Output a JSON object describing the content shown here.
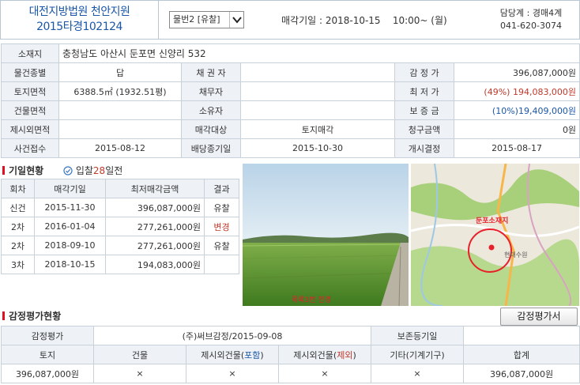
{
  "header": {
    "court_line1": "대전지방법원 천안지원",
    "court_line2": "2015타경102124",
    "item_select": "물번2 [유찰]",
    "sale_date_label": "매각기일 : 2018-10-15",
    "sale_time": "10:00~ (월)",
    "dept": "담당계 : 경매4계",
    "phone": "041-620-3074"
  },
  "info": {
    "address_label": "소재지",
    "address": "충청남도 아산시 둔포면 신양리 532",
    "type_label": "물건종별",
    "type": "답",
    "creditor_label": "채 권 자",
    "creditor": "",
    "appraisal_label": "감 정 가",
    "appraisal": "396,087,000원",
    "land_area_label": "토지면적",
    "land_area": "6388.5㎡ (1932.51평)",
    "debtor_label": "채무자",
    "debtor": "",
    "min_price_label": "최 저 가",
    "min_price": "(49%) 194,083,000원",
    "bldg_area_label": "건물면적",
    "bldg_area": "",
    "owner_label": "소유자",
    "owner": "",
    "deposit_label": "보 증 금",
    "deposit": "(10%)19,409,000원",
    "excluded_label": "제시외면적",
    "excluded": "",
    "target_label": "매각대상",
    "target": "토지매각",
    "claim_label": "청구금액",
    "claim": "0원",
    "case_recv_label": "사건접수",
    "case_recv": "2015-08-12",
    "dividend_label": "배당종기일",
    "dividend": "2015-10-30",
    "start_label": "개시결정",
    "start": "2015-08-17"
  },
  "history": {
    "title": "기일현황",
    "bid_prefix": "입찰",
    "bid_days": "28",
    "bid_suffix": "일전",
    "columns": [
      "회차",
      "매각기일",
      "최저매각금액",
      "결과"
    ],
    "rows": [
      {
        "round": "신건",
        "date": "2015-11-30",
        "price": "396,087,000원",
        "result": "유찰",
        "result_color": "#333333"
      },
      {
        "round": "2차",
        "date": "2016-01-04",
        "price": "277,261,000원",
        "result": "변경",
        "result_color": "#c0392b"
      },
      {
        "round": "2차",
        "date": "2018-09-10",
        "price": "277,261,000원",
        "result": "유찰",
        "result_color": "#333333"
      },
      {
        "round": "3차",
        "date": "2018-10-15",
        "price": "194,083,000원",
        "result": "",
        "result_color": "#333333"
      }
    ]
  },
  "photo": {
    "caption": "목록3번 전경"
  },
  "map": {
    "place_label": "둔포소재지",
    "place_label2": "현대수원"
  },
  "appraisal_sec": {
    "title": "감정평가현황",
    "button": "감정평가서",
    "row1_label": "감정평가",
    "row1_value": "(주)써브감정/2015-09-08",
    "row1_label2": "보존등기일",
    "row1_value2": "",
    "col_land": "토지",
    "col_bldg": "건물",
    "col_ext_incl_a": "제시외건물(",
    "col_ext_incl_b": "포함",
    "col_ext_excl_a": "제시외건물(",
    "col_ext_excl_b": "제외",
    "col_ext_close": ")",
    "col_etc": "기타(기계기구)",
    "col_total": "합계",
    "val_land": "396,087,000원",
    "val_bldg": "×",
    "val_ext_incl": "×",
    "val_ext_excl": "×",
    "val_etc": "×",
    "val_total": "396,087,000원"
  }
}
